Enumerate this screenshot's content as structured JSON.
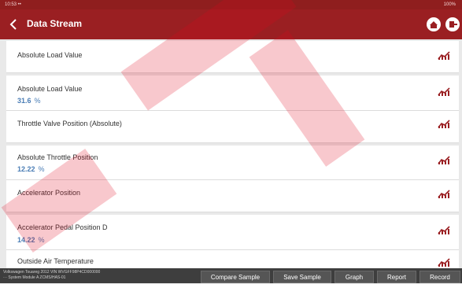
{
  "status_bar": {
    "left": "10:53 ••",
    "right": "100%"
  },
  "header": {
    "title": "Data Stream"
  },
  "rows": [
    {
      "label": "Absolute Load Value",
      "value": "",
      "unit": ""
    },
    {
      "label": "Absolute Load Value",
      "value": "31.6",
      "unit": "%"
    },
    {
      "label": "Throttle Valve Position (Absolute)",
      "value": "",
      "unit": ""
    },
    {
      "label": "Absolute Throttle Position",
      "value": "12.22",
      "unit": "%"
    },
    {
      "label": "Accelerator Position",
      "value": "",
      "unit": ""
    },
    {
      "label": "Accelerator Pedal Position D",
      "value": "14.22",
      "unit": "%"
    },
    {
      "label": "Outside Air Temperature",
      "value": "",
      "unit": ""
    }
  ],
  "footer": {
    "vehicle_line1": "Volkswagen  Touareg  2012  VIN  WVGFF98P4CD000000",
    "vehicle_line2": "··· System  Module A           ZCMS/HAS-01",
    "buttons": {
      "compare": "Compare Sample",
      "save": "Save Sample",
      "graph": "Graph",
      "report": "Report",
      "record": "Record"
    }
  },
  "colors": {
    "header": "#9a1f22",
    "value": "#4a7db5",
    "footer": "#3e3e3e"
  }
}
